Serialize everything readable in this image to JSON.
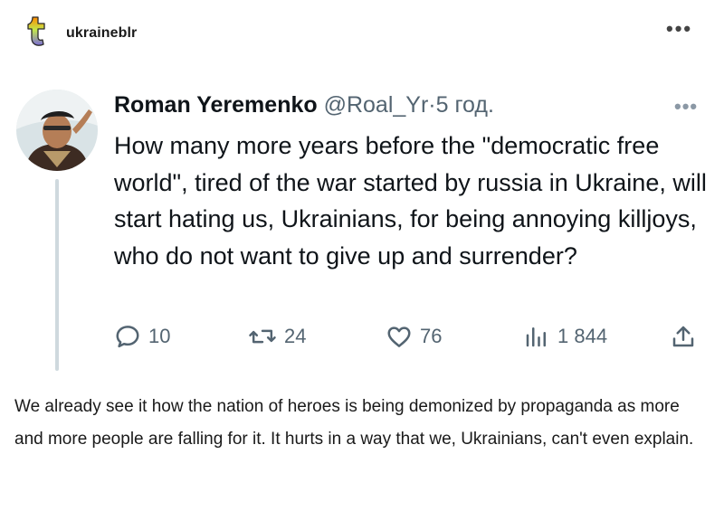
{
  "post": {
    "blog_name": "ukraineblr",
    "menu_label": "•••",
    "body_text": "We already see it how the nation of heroes is being demonized by propaganda as more and more people are falling for it. It hurts in a way that we, Ukrainians, can't even explain."
  },
  "tweet": {
    "author_name": "Roman Yeremenko",
    "handle": "@Roal_Yr",
    "separator": "·",
    "time": "5 год.",
    "more_label": "•••",
    "text": "How many more years before the \"democratic free world\", tired of the war started by russia in Ukraine, will start hating us, Ukrainians, for being annoying killjoys, who do not want to give up and surrender?",
    "actions": {
      "replies": "10",
      "reposts": "24",
      "likes": "76",
      "views": "1 844"
    }
  },
  "icons": {
    "logo": "tumblr-logo",
    "reply": "reply-icon",
    "repost": "repost-icon",
    "like": "heart-icon",
    "views": "views-icon",
    "share": "share-icon"
  },
  "colors": {
    "logo_gradient": [
      "#ff8a00",
      "#c2e84a",
      "#7b6bd9"
    ],
    "text_primary": "#0f1419",
    "text_secondary": "#536471",
    "thread_line": "#cfd9de"
  }
}
